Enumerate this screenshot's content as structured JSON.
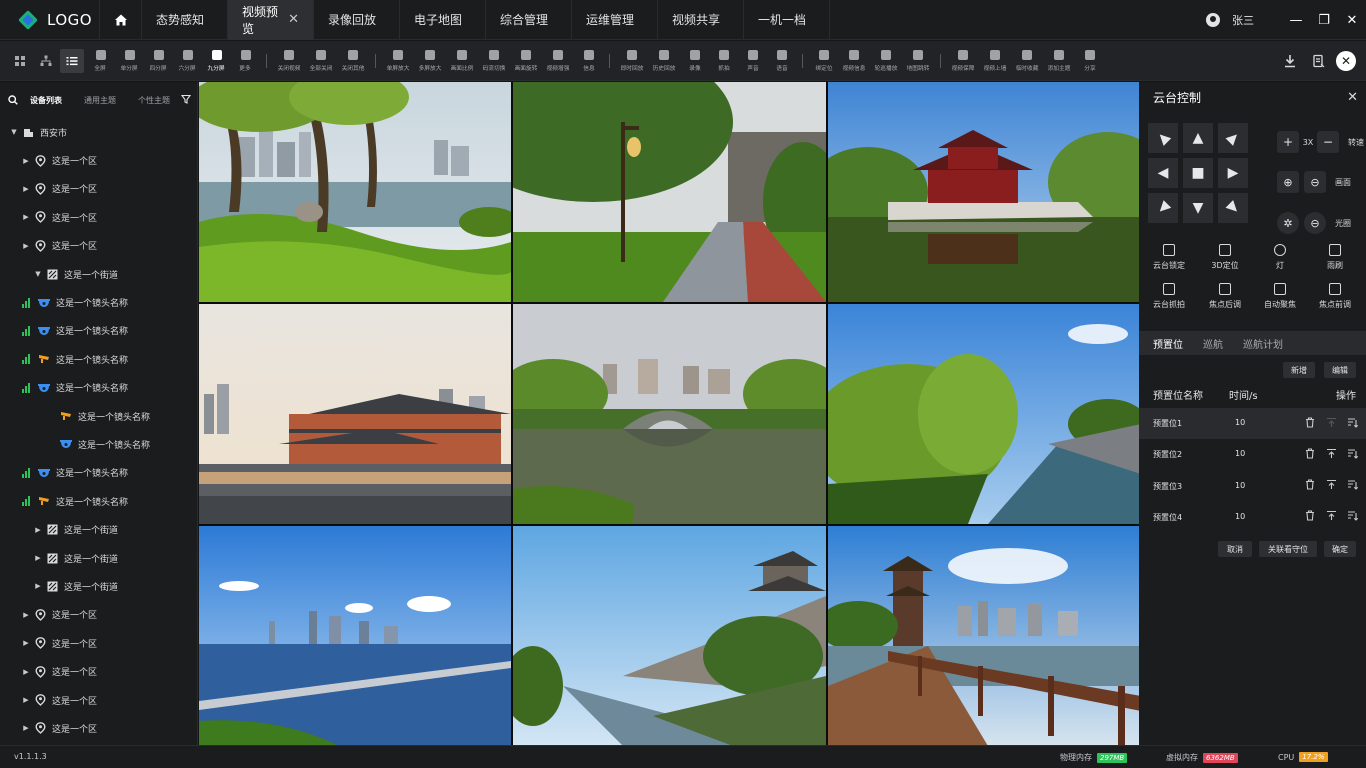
{
  "app": {
    "logo": "LOGO"
  },
  "nav": {
    "tabs": [
      "态势感知",
      "视频预览",
      "录像回放",
      "电子地图",
      "综合管理",
      "运维管理",
      "视频共享",
      "一机一档"
    ],
    "active_index": 1
  },
  "user": {
    "name": "张三"
  },
  "toolbar": {
    "groups": [
      [
        "全屏",
        "单分屏",
        "四分屏",
        "六分屏",
        "九分屏",
        "更多"
      ],
      [
        "关闭视频",
        "全部关闭",
        "关闭其他"
      ],
      [
        "单屏放大",
        "多屏放大",
        "画面比例",
        "码流切换",
        "画面旋转",
        "视频增强",
        "信息"
      ],
      [
        "即时回放",
        "历史回放",
        "录像",
        "抓拍",
        "声音",
        "语音"
      ],
      [
        "绑定位",
        "视频信息",
        "轮巡播放",
        "地图跳转"
      ],
      [
        "视频保障",
        "视频上墙",
        "临时收藏",
        "添加主题",
        "分享"
      ]
    ],
    "active": "九分屏"
  },
  "left": {
    "tabs": [
      "设备列表",
      "通用主题",
      "个性主题"
    ],
    "tree": [
      {
        "label": "西安市",
        "level": 0,
        "type": "city",
        "expanded": true
      },
      {
        "label": "这是一个区",
        "level": 1,
        "type": "district"
      },
      {
        "label": "这是一个区",
        "level": 1,
        "type": "district"
      },
      {
        "label": "这是一个区",
        "level": 1,
        "type": "district"
      },
      {
        "label": "这是一个区",
        "level": 1,
        "type": "district"
      },
      {
        "label": "这是一个街道",
        "level": 2,
        "type": "street",
        "expanded": true
      },
      {
        "label": "这是一个镜头名称",
        "level": 3,
        "type": "dome",
        "signal": true
      },
      {
        "label": "这是一个镜头名称",
        "level": 3,
        "type": "dome",
        "signal": true
      },
      {
        "label": "这是一个镜头名称",
        "level": 3,
        "type": "bullet",
        "signal": true
      },
      {
        "label": "这是一个镜头名称",
        "level": 3,
        "type": "dome",
        "signal": true
      },
      {
        "label": "这是一个镜头名称",
        "level": 3,
        "type": "bullet",
        "signal": false
      },
      {
        "label": "这是一个镜头名称",
        "level": 3,
        "type": "dome",
        "signal": false
      },
      {
        "label": "这是一个镜头名称",
        "level": 3,
        "type": "dome",
        "signal": true
      },
      {
        "label": "这是一个镜头名称",
        "level": 3,
        "type": "bullet",
        "signal": true
      },
      {
        "label": "这是一个街道",
        "level": 2,
        "type": "street"
      },
      {
        "label": "这是一个街道",
        "level": 2,
        "type": "street"
      },
      {
        "label": "这是一个街道",
        "level": 2,
        "type": "street"
      },
      {
        "label": "这是一个区",
        "level": 1,
        "type": "district"
      },
      {
        "label": "这是一个区",
        "level": 1,
        "type": "district"
      },
      {
        "label": "这是一个区",
        "level": 1,
        "type": "district"
      },
      {
        "label": "这是一个区",
        "level": 1,
        "type": "district"
      },
      {
        "label": "这是一个区",
        "level": 1,
        "type": "district"
      }
    ]
  },
  "ptz": {
    "title": "云台控制",
    "speed_label": "转速",
    "speed_value": "3X",
    "zoom_label": "画面",
    "iris_label": "光圈",
    "features": [
      "云台锁定",
      "3D定位",
      "灯",
      "雨刷",
      "云台抓拍",
      "焦点后调",
      "自动聚焦",
      "焦点前调"
    ],
    "tabs": [
      "预置位",
      "巡航",
      "巡航计划"
    ],
    "buttons": {
      "add": "新增",
      "edit": "编辑",
      "cancel": "取消",
      "link": "关联看守位",
      "confirm": "确定"
    },
    "table": {
      "headers": [
        "预置位名称",
        "时间/s",
        "操作"
      ],
      "rows": [
        {
          "name": "预置位1",
          "time": "10"
        },
        {
          "name": "预置位2",
          "time": "10"
        },
        {
          "name": "预置位3",
          "time": "10"
        },
        {
          "name": "预置位4",
          "time": "10"
        }
      ]
    }
  },
  "status": {
    "version": "v1.1.1.3",
    "physical_mem_label": "物理内存",
    "physical_mem_value": "297MB",
    "virtual_mem_label": "虚拟内存",
    "virtual_mem_value": "6362MB",
    "cpu_label": "CPU",
    "cpu_value": "17.2%"
  },
  "colors": {
    "ok": "#2fc25b",
    "danger": "#e0455a",
    "warn": "#f0a020",
    "camera_dome": "#3b8ff0",
    "camera_bullet": "#f0a020"
  }
}
